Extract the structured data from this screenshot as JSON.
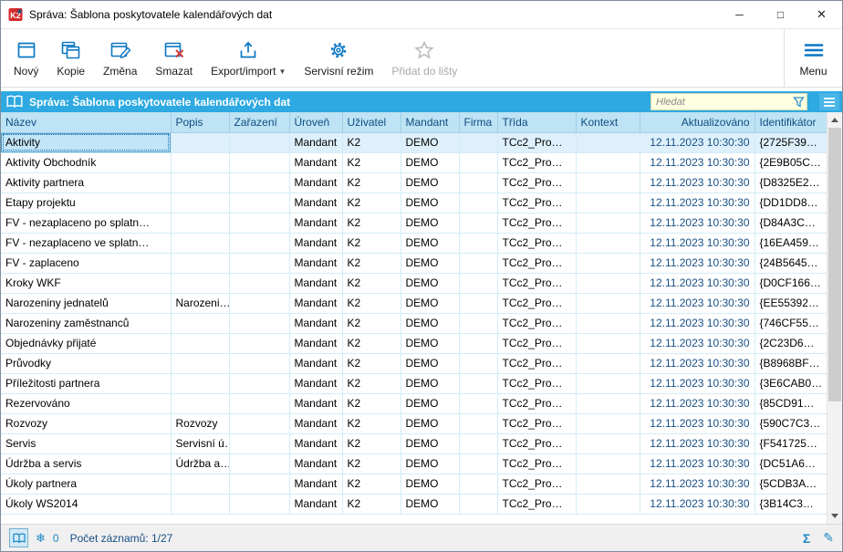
{
  "window": {
    "title": "Správa: Šablona poskytovatele kalendářových dat",
    "controls": {
      "minimize": "─",
      "maximize": "□",
      "close": "✕"
    }
  },
  "toolbar": {
    "buttons": [
      {
        "label": "Nový"
      },
      {
        "label": "Kopie"
      },
      {
        "label": "Změna"
      },
      {
        "label": "Smazat"
      },
      {
        "label": "Export/import"
      },
      {
        "label": "Servisní režim"
      },
      {
        "label": "Přidat do lišty"
      }
    ],
    "menu_label": "Menu"
  },
  "panel_header": {
    "title": "Správa: Šablona poskytovatele kalendářových dat",
    "search": {
      "placeholder": "Hledat",
      "value": ""
    }
  },
  "table": {
    "columns": [
      "Název",
      "Popis",
      "Zařazení",
      "Úroveň",
      "Uživatel",
      "Mandant",
      "Firma",
      "Třída",
      "Kontext",
      "Aktualizováno",
      "Identifikátor"
    ],
    "selected_row_index": 0,
    "rows": [
      [
        "Aktivity",
        "",
        "",
        "Mandant",
        "K2",
        "DEMO",
        "",
        "TCc2_Pro…",
        "",
        "12.11.2023 10:30:30",
        "{2725F39…"
      ],
      [
        "Aktivity Obchodník",
        "",
        "",
        "Mandant",
        "K2",
        "DEMO",
        "",
        "TCc2_Pro…",
        "",
        "12.11.2023 10:30:30",
        "{2E9B05C…"
      ],
      [
        "Aktivity partnera",
        "",
        "",
        "Mandant",
        "K2",
        "DEMO",
        "",
        "TCc2_Pro…",
        "",
        "12.11.2023 10:30:30",
        "{D8325E2…"
      ],
      [
        "Etapy projektu",
        "",
        "",
        "Mandant",
        "K2",
        "DEMO",
        "",
        "TCc2_Pro…",
        "",
        "12.11.2023 10:30:30",
        "{DD1DD8…"
      ],
      [
        "FV - nezaplaceno po splatn…",
        "",
        "",
        "Mandant",
        "K2",
        "DEMO",
        "",
        "TCc2_Pro…",
        "",
        "12.11.2023 10:30:30",
        "{D84A3C…"
      ],
      [
        "FV - nezaplaceno ve splatn…",
        "",
        "",
        "Mandant",
        "K2",
        "DEMO",
        "",
        "TCc2_Pro…",
        "",
        "12.11.2023 10:30:30",
        "{16EA459…"
      ],
      [
        "FV - zaplaceno",
        "",
        "",
        "Mandant",
        "K2",
        "DEMO",
        "",
        "TCc2_Pro…",
        "",
        "12.11.2023 10:30:30",
        "{24B5645…"
      ],
      [
        "Kroky WKF",
        "",
        "",
        "Mandant",
        "K2",
        "DEMO",
        "",
        "TCc2_Pro…",
        "",
        "12.11.2023 10:30:30",
        "{D0CF166…"
      ],
      [
        "Narozeniny jednatelů",
        "Narozeni…",
        "",
        "Mandant",
        "K2",
        "DEMO",
        "",
        "TCc2_Pro…",
        "",
        "12.11.2023 10:30:30",
        "{EE55392…"
      ],
      [
        "Narozeniny zaměstnanců",
        "",
        "",
        "Mandant",
        "K2",
        "DEMO",
        "",
        "TCc2_Pro…",
        "",
        "12.11.2023 10:30:30",
        "{746CF55…"
      ],
      [
        "Objednávky přijaté",
        "",
        "",
        "Mandant",
        "K2",
        "DEMO",
        "",
        "TCc2_Pro…",
        "",
        "12.11.2023 10:30:30",
        "{2C23D6…"
      ],
      [
        "Průvodky",
        "",
        "",
        "Mandant",
        "K2",
        "DEMO",
        "",
        "TCc2_Pro…",
        "",
        "12.11.2023 10:30:30",
        "{B8968BF…"
      ],
      [
        "Příležitosti partnera",
        "",
        "",
        "Mandant",
        "K2",
        "DEMO",
        "",
        "TCc2_Pro…",
        "",
        "12.11.2023 10:30:30",
        "{3E6CAB0…"
      ],
      [
        "Rezervováno",
        "",
        "",
        "Mandant",
        "K2",
        "DEMO",
        "",
        "TCc2_Pro…",
        "",
        "12.11.2023 10:30:30",
        "{85CD91…"
      ],
      [
        "Rozvozy",
        "Rozvozy",
        "",
        "Mandant",
        "K2",
        "DEMO",
        "",
        "TCc2_Pro…",
        "",
        "12.11.2023 10:30:30",
        "{590C7C3…"
      ],
      [
        "Servis",
        "Servisní ú…",
        "",
        "Mandant",
        "K2",
        "DEMO",
        "",
        "TCc2_Pro…",
        "",
        "12.11.2023 10:30:30",
        "{F541725…"
      ],
      [
        "Údržba a servis",
        "Údržba a…",
        "",
        "Mandant",
        "K2",
        "DEMO",
        "",
        "TCc2_Pro…",
        "",
        "12.11.2023 10:30:30",
        "{DC51A6…"
      ],
      [
        "Úkoly partnera",
        "",
        "",
        "Mandant",
        "K2",
        "DEMO",
        "",
        "TCc2_Pro…",
        "",
        "12.11.2023 10:30:30",
        "{5CDB3A…"
      ],
      [
        "Úkoly WS2014",
        "",
        "",
        "Mandant",
        "K2",
        "DEMO",
        "",
        "TCc2_Pro…",
        "",
        "12.11.2023 10:30:30",
        "{3B14C3…"
      ]
    ]
  },
  "status_bar": {
    "flake_count": "0",
    "record_count": "Počet záznamů: 1/27",
    "sigma": "Σ"
  },
  "colors": {
    "accent_blue": "#0B77C4",
    "panel_header_bg": "#2EA9E1",
    "column_header_bg": "#BEE3F4",
    "grid_line": "#D3ECF8",
    "selection_bg": "#C3E5F8",
    "search_bg": "#FFFFE1",
    "status_icon_blue": "#1E88C7"
  }
}
